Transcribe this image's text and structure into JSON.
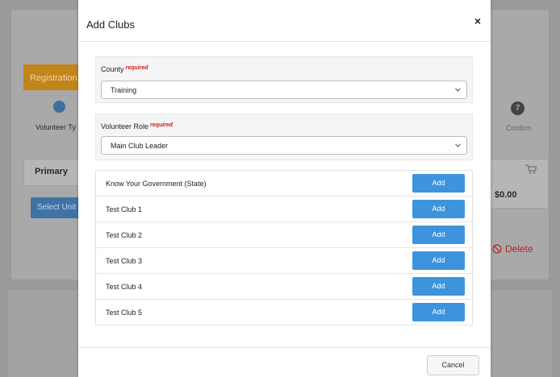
{
  "background": {
    "registration_tab": "Registration",
    "step1_label": "Volunteer Ty",
    "step7_number": "7",
    "confirm_label": "Confirm",
    "table_primary": "Primary",
    "amount": "$0.00",
    "select_unit_button": "Select Unit",
    "delete_label": "Delete"
  },
  "modal": {
    "title": "Add Clubs",
    "close": "×",
    "county": {
      "label": "County",
      "required": "required",
      "value": "Training"
    },
    "volunteer_role": {
      "label": "Volunteer Role",
      "required": "required",
      "value": "Main Club Leader"
    },
    "clubs": [
      {
        "name": "Know Your Government (State)",
        "action": "Add"
      },
      {
        "name": "Test Club 1",
        "action": "Add"
      },
      {
        "name": "Test Club 2",
        "action": "Add"
      },
      {
        "name": "Test Club 3",
        "action": "Add"
      },
      {
        "name": "Test Club 4",
        "action": "Add"
      },
      {
        "name": "Test Club 5",
        "action": "Add"
      }
    ],
    "cancel": "Cancel"
  },
  "colors": {
    "accent": "#3d94dd",
    "required": "#d41a1a",
    "registration_tab": "#c2851a",
    "delete": "#b02929"
  },
  "icons": {
    "close": "close-icon",
    "dropdown": "chevron-down-icon",
    "cart": "cart-icon",
    "delete": "ban-icon"
  }
}
